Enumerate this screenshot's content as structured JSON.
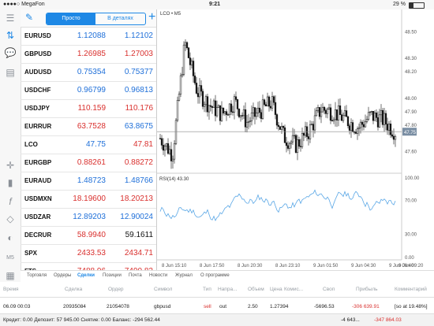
{
  "status_bar": {
    "carrier": "●●●●○ MegaFon",
    "time": "9:21",
    "battery": "29 %"
  },
  "quotes_toolbar": {
    "tab_simple": "Просто",
    "tab_detailed": "В деталях",
    "add": "+"
  },
  "quotes": [
    {
      "symbol": "EURUSD",
      "bid": "1.12088",
      "ask": "1.12102",
      "bid_color": "up",
      "ask_color": "up"
    },
    {
      "symbol": "GBPUSD",
      "bid": "1.26985",
      "ask": "1.27003",
      "bid_color": "dn",
      "ask_color": "dn"
    },
    {
      "symbol": "AUDUSD",
      "bid": "0.75354",
      "ask": "0.75377",
      "bid_color": "up",
      "ask_color": "up"
    },
    {
      "symbol": "USDCHF",
      "bid": "0.96799",
      "ask": "0.96813",
      "bid_color": "up",
      "ask_color": "up"
    },
    {
      "symbol": "USDJPY",
      "bid": "110.159",
      "ask": "110.176",
      "bid_color": "dn",
      "ask_color": "dn"
    },
    {
      "symbol": "EURRUR",
      "bid": "63.7528",
      "ask": "63.8675",
      "bid_color": "dn",
      "ask_color": "up"
    },
    {
      "symbol": "LCO",
      "bid": "47.75",
      "ask": "47.81",
      "bid_color": "up",
      "ask_color": "dn"
    },
    {
      "symbol": "EURGBP",
      "bid": "0.88261",
      "ask": "0.88272",
      "bid_color": "dn",
      "ask_color": "dn"
    },
    {
      "symbol": "EURAUD",
      "bid": "1.48723",
      "ask": "1.48766",
      "bid_color": "up",
      "ask_color": "up"
    },
    {
      "symbol": "USDMXN",
      "bid": "18.19600",
      "ask": "18.20213",
      "bid_color": "dn",
      "ask_color": "dn"
    },
    {
      "symbol": "USDZAR",
      "bid": "12.89203",
      "ask": "12.90024",
      "bid_color": "up",
      "ask_color": "up"
    },
    {
      "symbol": "DECRUR",
      "bid": "58.9940",
      "ask": "59.1611",
      "bid_color": "dn",
      "ask_color": "nt"
    },
    {
      "symbol": "SPX",
      "bid": "2433.53",
      "ask": "2434.71",
      "bid_color": "dn",
      "ask_color": "dn"
    },
    {
      "symbol": "FTS",
      "bid": "7488.96",
      "ask": "7490.82",
      "bid_color": "dn",
      "ask_color": "dn"
    }
  ],
  "chart": {
    "symbol_label": "LCO • M5",
    "rsi_label": "RSI(14) 43.30",
    "price_ticks": [
      "48.50",
      "48.30",
      "48.20",
      "48.00",
      "47.90",
      "47.80",
      "47.60"
    ],
    "current_price": "47.75",
    "rsi_ticks": [
      "100.00",
      "70.00",
      "30.00",
      "0.00"
    ],
    "time_ticks": [
      "8 Jun 15:10",
      "8 Jun 17:50",
      "8 Jun 20:30",
      "8 Jun 23:10",
      "9 Jun 01:50",
      "9 Jun 04:30",
      "9 Jun 06:40",
      "9 Jun 09:20"
    ],
    "colors": {
      "candle": "#111111",
      "rsi_line": "#5aa7e6",
      "price_line": "#888888",
      "price_tag": "#7a8ea3"
    }
  },
  "chart_data": {
    "type": "line",
    "title": "LCO • M5",
    "ylim": [
      47.45,
      48.62
    ],
    "x": [
      "8 Jun 15:10",
      "8 Jun 17:50",
      "8 Jun 20:30",
      "8 Jun 23:10",
      "9 Jun 01:50",
      "9 Jun 04:30",
      "9 Jun 06:40",
      "9 Jun 09:20"
    ],
    "series": [
      {
        "values": [
          47.7,
          47.58,
          48.42,
          48.05,
          47.95,
          47.88,
          47.98,
          47.82,
          47.9,
          47.97,
          47.71,
          47.65,
          47.75,
          47.92,
          47.9,
          47.84,
          47.78,
          47.87,
          47.84,
          47.75
        ]
      }
    ]
  },
  "bottom_tabs": [
    "Торговля",
    "Ордеры",
    "Сделки",
    "Позиции",
    "Почта",
    "Новости",
    "Журнал",
    "О программе"
  ],
  "active_tab": "Сделки",
  "table_headers": [
    "Время",
    "Сделка",
    "Ордер",
    "Символ",
    "Тип",
    "Напра...",
    "Объем",
    "Цена",
    "Комис...",
    "Своп",
    "Прибыль",
    "Комментарий"
  ],
  "deal_row": [
    "06.09 00:03",
    "20935084",
    "21054078",
    "gbpusd",
    "sell",
    "out",
    "2.50",
    "1.27394",
    "",
    "-5696.53",
    "-306 639.91",
    "[so at 19.48%]"
  ],
  "footer": {
    "left": "Кредит: 0.00 Депозит: 57 945.00 Снятие: 0.00 Баланс: -294 562.44",
    "swap": "-4 643...",
    "profit": "-347 864.03"
  }
}
